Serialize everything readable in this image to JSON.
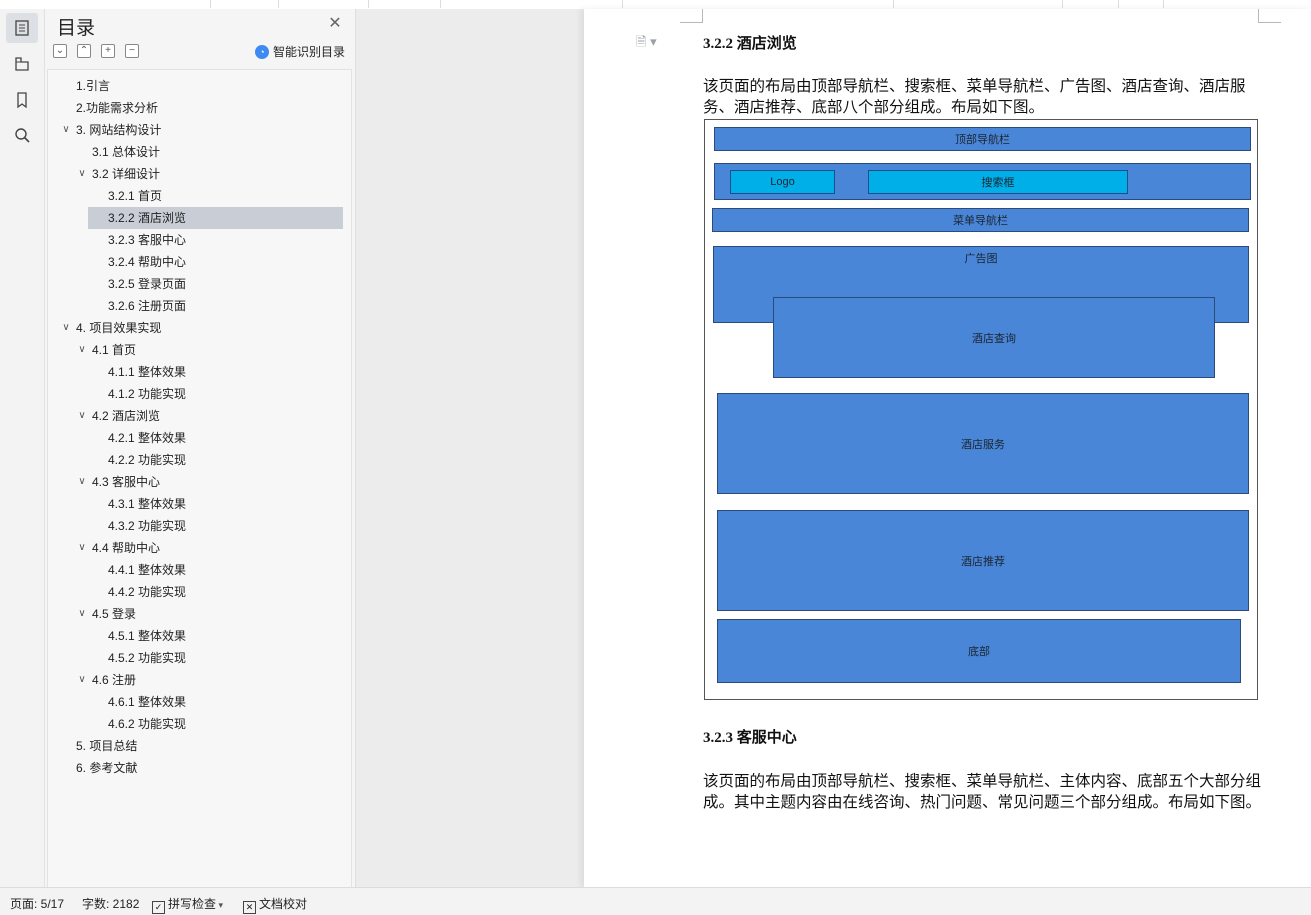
{
  "toc_panel": {
    "title": "目录",
    "close_icon": "close-icon",
    "toolbar_icons": [
      "collapse-all-icon",
      "expand-all-icon",
      "add-heading-icon",
      "remove-heading-icon"
    ],
    "smart_label": "智能识别目录",
    "items": [
      {
        "label": "1.引言",
        "level": 1,
        "expandable": false,
        "selected": false
      },
      {
        "label": "2.功能需求分析",
        "level": 1,
        "expandable": false,
        "selected": false
      },
      {
        "label": "3.  网站结构设计",
        "level": 1,
        "expandable": true,
        "selected": false
      },
      {
        "label": "3.1 总体设计",
        "level": 2,
        "expandable": false,
        "selected": false
      },
      {
        "label": "3.2 详细设计",
        "level": 2,
        "expandable": true,
        "selected": false
      },
      {
        "label": "3.2.1 首页",
        "level": 3,
        "expandable": false,
        "selected": false
      },
      {
        "label": "3.2.2 酒店浏览",
        "level": 3,
        "expandable": false,
        "selected": true
      },
      {
        "label": "3.2.3 客服中心",
        "level": 3,
        "expandable": false,
        "selected": false
      },
      {
        "label": "3.2.4 帮助中心",
        "level": 3,
        "expandable": false,
        "selected": false
      },
      {
        "label": "3.2.5 登录页面",
        "level": 3,
        "expandable": false,
        "selected": false
      },
      {
        "label": "3.2.6 注册页面",
        "level": 3,
        "expandable": false,
        "selected": false
      },
      {
        "label": "4.  项目效果实现",
        "level": 1,
        "expandable": true,
        "selected": false
      },
      {
        "label": "4.1 首页",
        "level": 2,
        "expandable": true,
        "selected": false
      },
      {
        "label": "4.1.1 整体效果",
        "level": 3,
        "expandable": false,
        "selected": false
      },
      {
        "label": "4.1.2 功能实现",
        "level": 3,
        "expandable": false,
        "selected": false
      },
      {
        "label": "4.2 酒店浏览",
        "level": 2,
        "expandable": true,
        "selected": false
      },
      {
        "label": "4.2.1 整体效果",
        "level": 3,
        "expandable": false,
        "selected": false
      },
      {
        "label": "4.2.2 功能实现",
        "level": 3,
        "expandable": false,
        "selected": false
      },
      {
        "label": "4.3 客服中心",
        "level": 2,
        "expandable": true,
        "selected": false
      },
      {
        "label": "4.3.1 整体效果",
        "level": 3,
        "expandable": false,
        "selected": false
      },
      {
        "label": "4.3.2 功能实现",
        "level": 3,
        "expandable": false,
        "selected": false
      },
      {
        "label": "4.4 帮助中心",
        "level": 2,
        "expandable": true,
        "selected": false
      },
      {
        "label": "4.4.1 整体效果",
        "level": 3,
        "expandable": false,
        "selected": false
      },
      {
        "label": "4.4.2 功能实现",
        "level": 3,
        "expandable": false,
        "selected": false
      },
      {
        "label": "4.5 登录",
        "level": 2,
        "expandable": true,
        "selected": false
      },
      {
        "label": "4.5.1 整体效果",
        "level": 3,
        "expandable": false,
        "selected": false
      },
      {
        "label": "4.5.2 功能实现",
        "level": 3,
        "expandable": false,
        "selected": false
      },
      {
        "label": "4.6 注册",
        "level": 2,
        "expandable": true,
        "selected": false
      },
      {
        "label": "4.6.1 整体效果",
        "level": 3,
        "expandable": false,
        "selected": false
      },
      {
        "label": "4.6.2 功能实现",
        "level": 3,
        "expandable": false,
        "selected": false
      },
      {
        "label": "5.  项目总结",
        "level": 1,
        "expandable": false,
        "selected": false
      },
      {
        "label": "6.  参考文献",
        "level": 1,
        "expandable": false,
        "selected": false
      }
    ]
  },
  "rail": {
    "icons": [
      "toc-icon",
      "outline-icon",
      "bookmark-icon",
      "search-icon"
    ]
  },
  "document": {
    "section1_heading": "3.2.2 酒店浏览",
    "section1_paragraph": "该页面的布局由顶部导航栏、搜索框、菜单导航栏、广告图、酒店查询、酒店服务、酒店推荐、底部八个部分组成。布局如下图。",
    "diagram": {
      "top_nav": "顶部导航栏",
      "logo": "Logo",
      "search": "搜索框",
      "menu_nav": "菜单导航栏",
      "banner": "广告图",
      "hotel_query": "酒店查询",
      "hotel_service": "酒店服务",
      "hotel_recommend": "酒店推荐",
      "footer": "底部",
      "block_color": "#4a86d8",
      "highlight_color": "#00aee8"
    },
    "section2_heading": "3.2.3 客服中心",
    "section2_paragraph": "该页面的布局由顶部导航栏、搜索框、菜单导航栏、主体内容、底部五个大部分组成。其中主题内容由在线咨询、热门问题、常见问题三个部分组成。布局如下图。"
  },
  "status_bar": {
    "page": "页面: 5/17",
    "words": "字数: 2182",
    "spell_check": "拼写检查",
    "proofread": "文档校对"
  }
}
